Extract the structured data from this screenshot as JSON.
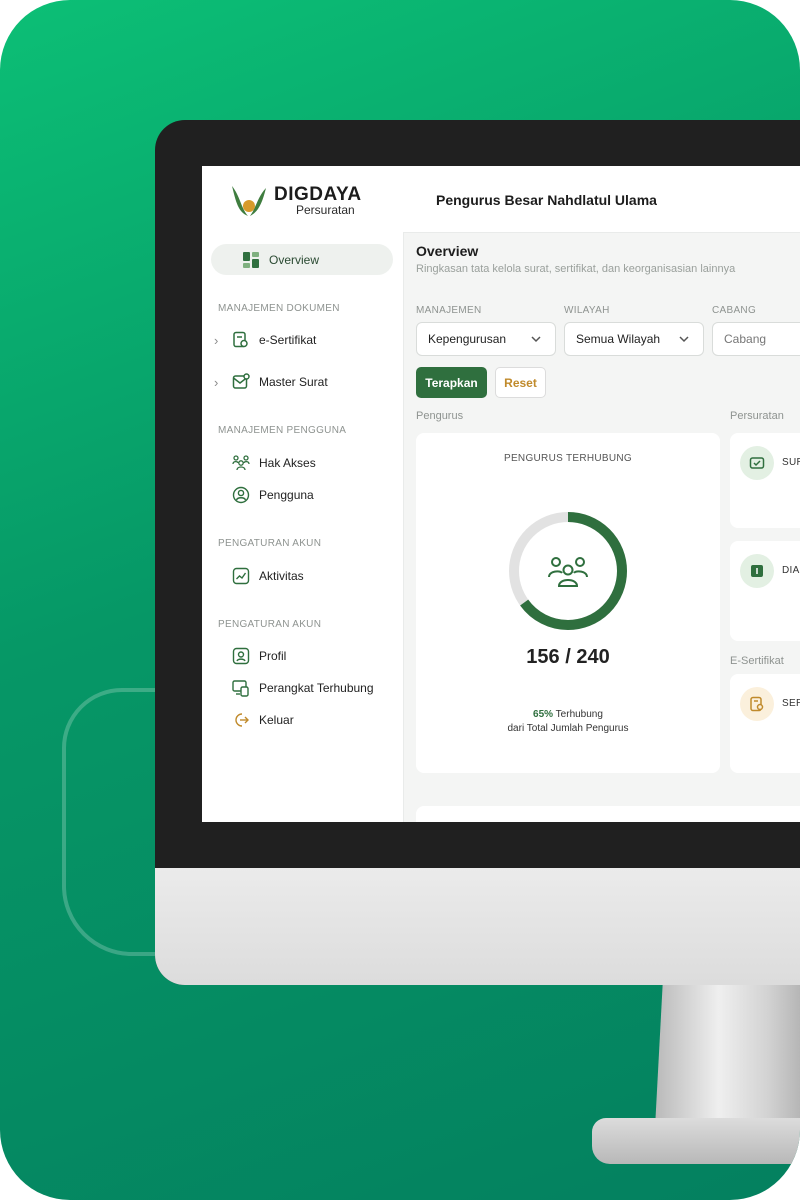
{
  "app": {
    "brand_title": "DIGDAYA",
    "brand_subtitle": "Persuratan",
    "organization": "Pengurus Besar Nahdlatul Ulama"
  },
  "sidebar": {
    "active_item": {
      "label": "Overview",
      "icon": "grid-icon"
    },
    "sections": [
      {
        "title": "MANAJEMEN DOKUMEN",
        "items": [
          {
            "label": "e-Sertifikat",
            "icon": "certificate-icon",
            "expandable": true
          },
          {
            "label": "Master Surat",
            "icon": "mail-settings-icon",
            "expandable": true
          }
        ]
      },
      {
        "title": "MANAJEMEN PENGGUNA",
        "items": [
          {
            "label": "Hak Akses",
            "icon": "users-group-icon"
          },
          {
            "label": "Pengguna",
            "icon": "user-circle-icon"
          }
        ]
      },
      {
        "title": "PENGATURAN AKUN",
        "items": [
          {
            "label": "Aktivitas",
            "icon": "activity-chart-icon"
          }
        ]
      },
      {
        "title": "PENGATURAN AKUN",
        "items": [
          {
            "label": "Profil",
            "icon": "profile-icon"
          },
          {
            "label": "Perangkat Terhubung",
            "icon": "devices-icon"
          },
          {
            "label": "Keluar",
            "icon": "logout-icon"
          }
        ]
      }
    ]
  },
  "main": {
    "title": "Overview",
    "subtitle": "Ringkasan tata kelola surat, sertifikat, dan keorganisasian lainnya",
    "filters": [
      {
        "label": "MANAJEMEN",
        "value": "Kepengurusan"
      },
      {
        "label": "WILAYAH",
        "value": "Semua Wilayah"
      },
      {
        "label": "CABANG",
        "placeholder": "Cabang"
      }
    ],
    "apply_label": "Terapkan",
    "reset_label": "Reset",
    "groups": {
      "pengurus": "Pengurus",
      "persuratan": "Persuratan",
      "esertifikat": "E-Sertifikat"
    },
    "pengurus_card": {
      "title": "PENGURUS TERHUBUNG",
      "count_text": "156 / 240",
      "connected": 156,
      "total": 240,
      "percent_text": "65%",
      "percent_value": 0.65,
      "percent_label": "Terhubung",
      "caption": "dari Total Jumlah Pengurus"
    },
    "persuratan_cards": [
      {
        "label": "SUR",
        "icon": "mail-check-icon"
      },
      {
        "label": "DIA",
        "icon": "document-icon"
      }
    ],
    "sertifikat_cards": [
      {
        "label": "SER",
        "icon": "certificate-icon"
      }
    ]
  },
  "colors": {
    "primary": "#2f6f3e",
    "accent": "#c08a2b",
    "background_green": "#069766",
    "donut_track": "#e2e2e2"
  }
}
